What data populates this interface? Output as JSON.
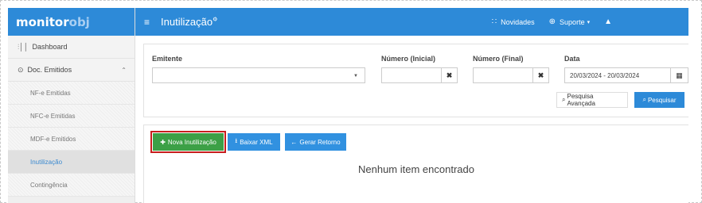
{
  "logo": {
    "part1": "monitor",
    "part2": "obj"
  },
  "sidebar": {
    "items": [
      {
        "label": "Dashboard"
      },
      {
        "label": "Doc. Emitidos"
      }
    ],
    "subitems": [
      {
        "label": "NF-e Emitidas"
      },
      {
        "label": "NFC-e Emitidas"
      },
      {
        "label": "MDF-e Emitidos"
      },
      {
        "label": "Inutilização",
        "active": true
      },
      {
        "label": "Contingência"
      }
    ]
  },
  "header": {
    "title": "Inutilização",
    "novidades": "Novidades",
    "suporte": "Suporte"
  },
  "filters": {
    "emitente_label": "Emitente",
    "emitente_value": "",
    "num_inicial_label": "Número (Inicial)",
    "num_inicial_value": "",
    "num_final_label": "Número (Final)",
    "num_final_value": "",
    "data_label": "Data",
    "data_value": "20/03/2024 - 20/03/2024",
    "advanced_search": "Pesquisa Avançada",
    "search": "Pesquisar"
  },
  "actions": {
    "nova": "Nova Inutilização",
    "baixar": "Baixar XML",
    "gerar": "Gerar Retorno"
  },
  "results": {
    "empty_message": "Nenhum item encontrado"
  },
  "colors": {
    "primary": "#2d8ad8",
    "success": "#3ca046",
    "highlight": "#c81e1e"
  }
}
